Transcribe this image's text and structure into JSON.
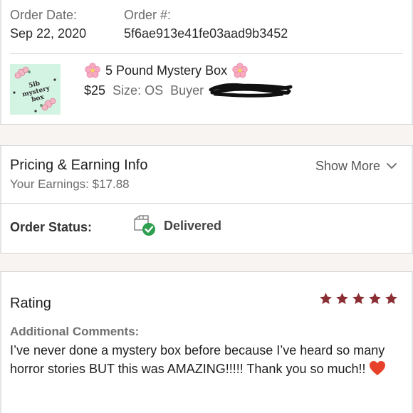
{
  "order": {
    "date_label": "Order Date:",
    "date_value": "Sep 22, 2020",
    "number_label": "Order #:",
    "number_value": "5f6ae913e41fe03aad9b3452"
  },
  "product": {
    "thumbnail_text": "5lb mystery box",
    "title": "5 Pound Mystery Box",
    "price": "$25",
    "size": "Size: OS",
    "buyer_label": "Buyer",
    "title_icon": "cherry-blossom-icon"
  },
  "pricing": {
    "title": "Pricing & Earning Info",
    "earnings": "Your Earnings: $17.88",
    "show_more": "Show More"
  },
  "status": {
    "label": "Order Status:",
    "value": "Delivered",
    "icon": "delivered-box-check-icon"
  },
  "rating": {
    "title": "Rating",
    "stars": 5,
    "max_stars": 5,
    "comments_label": "Additional Comments:",
    "comments_text": "I’ve never done a mystery box before because I’ve heard so many horror stories BUT this was AMAZING!!!!! Thank you so much!!"
  },
  "colors": {
    "star": "#8a2e33",
    "status_check": "#2e9e4f",
    "thumbnail_bg": "#d3f3e3",
    "section_gap": "#f7f4f2",
    "heart": "#e8412b"
  }
}
